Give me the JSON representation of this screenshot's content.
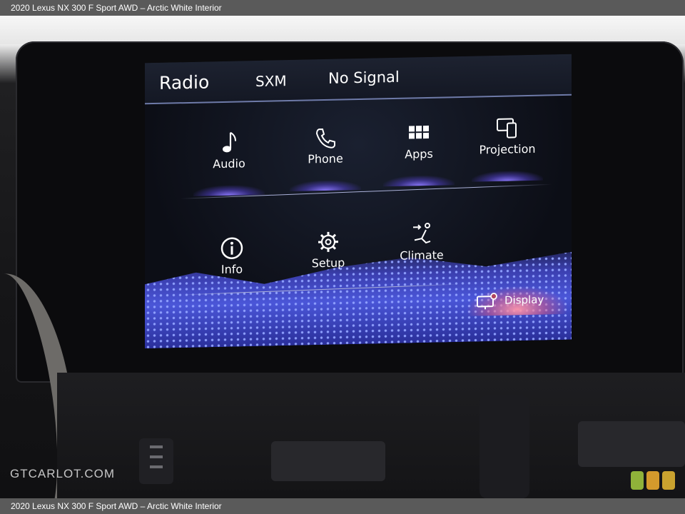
{
  "caption": "2020 Lexus NX 300 F Sport AWD – Arctic White Interior",
  "watermark": "GTCARLOT.COM",
  "screen": {
    "header": {
      "source": "Radio",
      "band": "SXM",
      "status": "No Signal"
    },
    "menu_row1": [
      {
        "label": "Audio",
        "icon": "music-note-icon"
      },
      {
        "label": "Phone",
        "icon": "phone-icon"
      },
      {
        "label": "Apps",
        "icon": "grid-icon"
      },
      {
        "label": "Projection",
        "icon": "projection-icon"
      }
    ],
    "menu_row2": [
      {
        "label": "Info",
        "icon": "info-icon"
      },
      {
        "label": "Setup",
        "icon": "gear-icon"
      },
      {
        "label": "Climate",
        "icon": "climate-seat-icon"
      }
    ],
    "display_button": {
      "label": "Display",
      "icon": "display-icon"
    }
  },
  "colors": {
    "menu_glow": "#8c78ff",
    "display_glow": "#ff96aa",
    "header_rule": "#6e7aa8"
  }
}
